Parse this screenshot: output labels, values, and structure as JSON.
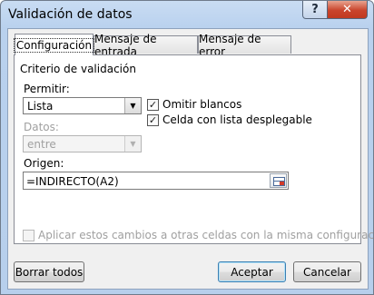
{
  "window": {
    "title": "Validación de datos",
    "help_glyph": "?",
    "close_glyph": "✕"
  },
  "tabs": [
    {
      "label": "Configuración",
      "active": true
    },
    {
      "label": "Mensaje de entrada",
      "active": false
    },
    {
      "label": "Mensaje de error",
      "active": false
    }
  ],
  "settings": {
    "group_label": "Criterio de validación",
    "allow": {
      "label": "Permitir:",
      "value": "Lista"
    },
    "data": {
      "label": "Datos:",
      "value": "entre"
    },
    "ignore_blank": {
      "label": "Omitir blancos",
      "checked": true
    },
    "in_cell_dropdown": {
      "label": "Celda con lista desplegable",
      "checked": true
    },
    "source": {
      "label": "Origen:",
      "value": "=INDIRECTO(A2)"
    },
    "apply_all": {
      "label": "Aplicar estos cambios a otras celdas con la misma configuración",
      "checked": false
    }
  },
  "buttons": {
    "clear_all": "Borrar todos",
    "ok": "Aceptar",
    "cancel": "Cancelar"
  },
  "glyphs": {
    "dropdown_arrow": "▼",
    "checkmark": "✓"
  }
}
